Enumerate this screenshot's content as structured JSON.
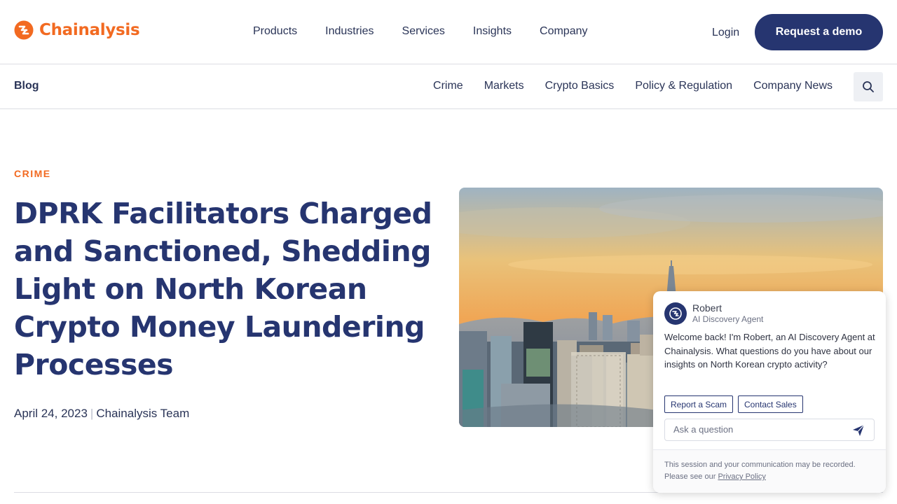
{
  "brand": {
    "name": "Chainalysis",
    "color": "#f26a21",
    "logo_icon": "chainalysis-logo-icon"
  },
  "header": {
    "nav": [
      "Products",
      "Industries",
      "Services",
      "Insights",
      "Company"
    ],
    "login_label": "Login",
    "demo_label": "Request a demo",
    "demo_color": "#263570"
  },
  "subnav": {
    "title": "Blog",
    "items": [
      "Crime",
      "Markets",
      "Crypto Basics",
      "Policy & Regulation",
      "Company News"
    ],
    "search_icon": "search-icon"
  },
  "article": {
    "category": "CRIME",
    "title": "DPRK Facilitators Charged and Sanctioned, Shedding Light on North Korean Crypto Money Laundering Processes",
    "date": "April 24, 2023",
    "separator": "|",
    "author": "Chainalysis Team",
    "title_color": "#263570"
  },
  "chat": {
    "agent_name": "Robert",
    "agent_role": "AI Discovery Agent",
    "message": "Welcome back! I'm Robert, an AI Discovery Agent at Chainalysis. What questions do you have about our insights on North Korean crypto activity?",
    "chips": [
      "Report a Scam",
      "Contact Sales"
    ],
    "input_placeholder": "Ask a question",
    "send_icon": "send-icon",
    "footer_text": "This session and your communication may be recorded. Please see our",
    "privacy_link": "Privacy Policy"
  }
}
